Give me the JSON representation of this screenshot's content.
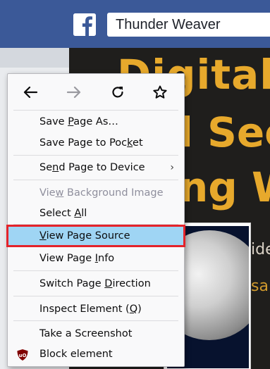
{
  "facebook": {
    "logo_letter": "f",
    "search_value": "Thunder Weaver",
    "brand_color": "#3b5998"
  },
  "poster": {
    "line1": "Digital F",
    "line2": "l Sec",
    "line3": "ng W",
    "side_text_1": "ide",
    "side_text_2": "sar",
    "accent_color": "#e7a92c"
  },
  "context_menu": {
    "nav": {
      "back_icon": "arrow-left-icon",
      "forward_icon": "arrow-right-icon",
      "reload_icon": "reload-icon",
      "bookmark_icon": "star-icon"
    },
    "items": [
      {
        "pre": "Save ",
        "acc": "P",
        "post": "age As…",
        "disabled": false,
        "submenu": false
      },
      {
        "pre": "Save Page to Poc",
        "acc": "k",
        "post": "et",
        "disabled": false,
        "submenu": false
      },
      {
        "pre": "Se",
        "acc": "n",
        "post": "d Page to Device",
        "disabled": false,
        "submenu": true,
        "submenu_glyph": "›"
      },
      {
        "pre": "Vie",
        "acc": "w",
        "post": " Background Image",
        "disabled": true,
        "submenu": false
      },
      {
        "pre": "Select ",
        "acc": "A",
        "post": "ll",
        "disabled": false,
        "submenu": false
      },
      {
        "pre": "",
        "acc": "V",
        "post": "iew Page Source",
        "disabled": false,
        "submenu": false,
        "highlighted": true
      },
      {
        "pre": "View Page ",
        "acc": "I",
        "post": "nfo",
        "disabled": false,
        "submenu": false
      },
      {
        "pre": "Switch Page ",
        "acc": "D",
        "post": "irection",
        "disabled": false,
        "submenu": false
      },
      {
        "pre": "Inspect Element (",
        "acc": "Q",
        "post": ")",
        "disabled": false,
        "submenu": false
      },
      {
        "pre": "Take a Screenshot",
        "acc": "",
        "post": "",
        "disabled": false,
        "submenu": false
      },
      {
        "pre": "Block element",
        "acc": "",
        "post": "",
        "disabled": false,
        "submenu": false,
        "icon": "ublock-origin-icon",
        "icon_label": "uO"
      }
    ],
    "highlight_color": "#9fd5f4",
    "callout_color": "#e4232a"
  }
}
